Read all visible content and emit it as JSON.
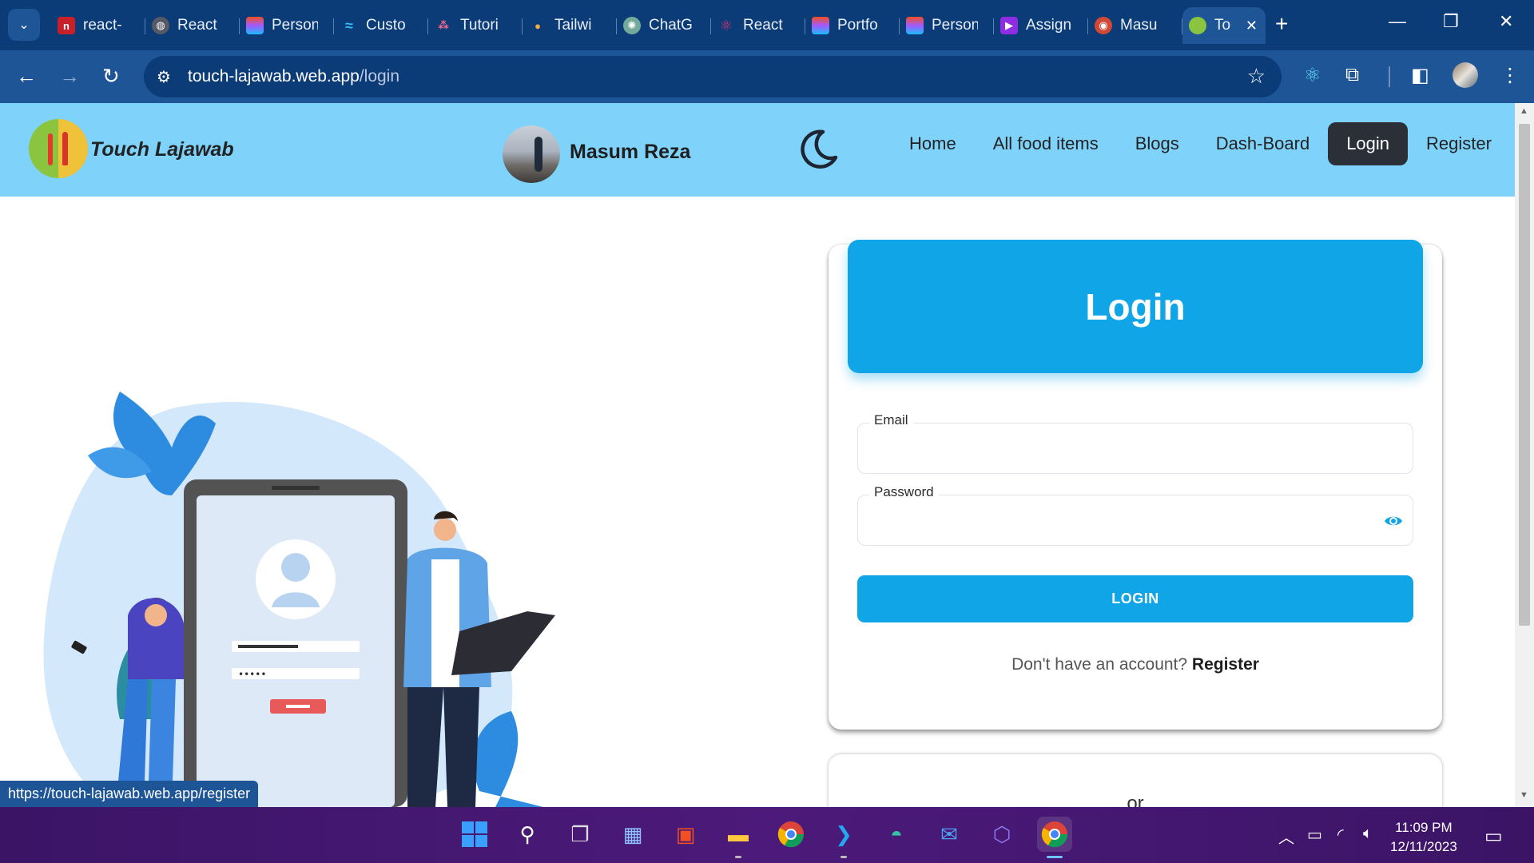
{
  "browser": {
    "tabs": [
      {
        "label": "react-",
        "icon": "notion-icon",
        "color": "#c8202b"
      },
      {
        "label": "React",
        "icon": "globe-icon",
        "color": "#555a66"
      },
      {
        "label": "Person",
        "icon": "figma-icon",
        "color": "#f24e1e"
      },
      {
        "label": "Custo",
        "icon": "tailwind-icon",
        "color": "#38bdf8"
      },
      {
        "label": "Tutori",
        "icon": "dots-icon",
        "color": "#6c63ff"
      },
      {
        "label": "Tailwi",
        "icon": "person-icon",
        "color": "#f5b041"
      },
      {
        "label": "ChatG",
        "icon": "chatgpt-icon",
        "color": "#74aa9c"
      },
      {
        "label": "React",
        "icon": "react-icon",
        "color": "#e1306c"
      },
      {
        "label": "Portfo",
        "icon": "figma-icon",
        "color": "#f24e1e"
      },
      {
        "label": "Person",
        "icon": "figma-icon",
        "color": "#f24e1e"
      },
      {
        "label": "Assign",
        "icon": "assign-icon",
        "color": "#8e2de2"
      },
      {
        "label": "Masu",
        "icon": "chrome-avatar-icon",
        "color": "#d14836"
      }
    ],
    "active_tab": {
      "label": "To",
      "icon": "site-logo-icon"
    },
    "url_host": "touch-lajawab.web.app",
    "url_path": "/login",
    "status_url": "https://touch-lajawab.web.app/register"
  },
  "site": {
    "brand": "Touch Lajawab",
    "profile_name": "Masum Reza",
    "nav": [
      "Home",
      "All food items",
      "Blogs",
      "Dash-Board",
      "Login",
      "Register"
    ],
    "active_nav": "Login"
  },
  "login": {
    "title": "Login",
    "email_label": "Email",
    "email_value": "",
    "password_label": "Password",
    "password_value": "",
    "button": "LOGIN",
    "no_account_text": "Don't have an account?",
    "register_link": "Register",
    "or_text": "or"
  },
  "taskbar": {
    "time": "11:09 PM",
    "date": "12/11/2023"
  },
  "colors": {
    "navbar_bg": "#7fd3fb",
    "accent": "#0fa5e6",
    "active_nav_bg": "#2b2f37",
    "chrome_dark": "#0c3c78",
    "chrome_mid": "#1d5596"
  }
}
